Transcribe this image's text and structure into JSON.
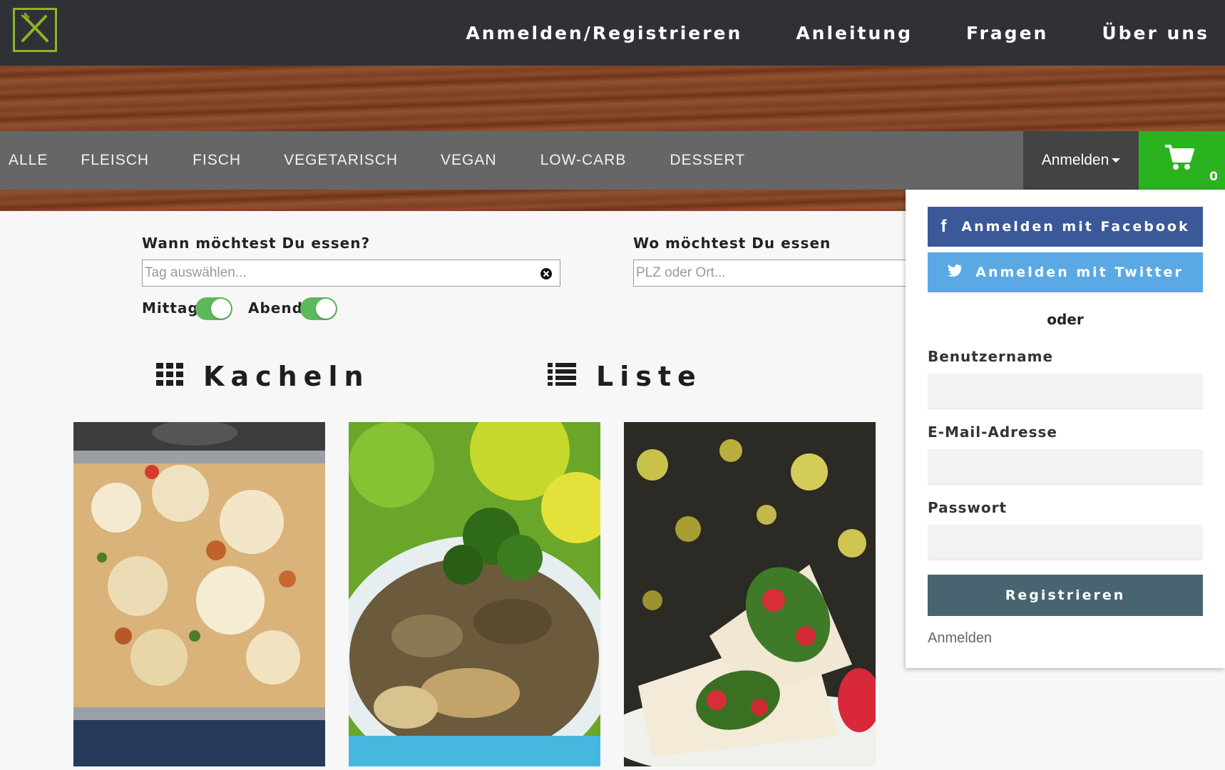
{
  "header": {
    "logo_icon": "fork-knife-icon",
    "nav": [
      "Anmelden/Registrieren",
      "Anleitung",
      "Fragen",
      "Über uns"
    ]
  },
  "categories": [
    "ALLE",
    "FLEISCH",
    "FISCH",
    "VEGETARISCH",
    "VEGAN",
    "LOW-CARB",
    "DESSERT"
  ],
  "account": {
    "dropdown_label": "Anmelden",
    "cart_count": "0"
  },
  "filters": {
    "when_label": "Wann möchtest Du essen?",
    "when_placeholder": "Tag auswählen...",
    "where_label": "Wo möchtest Du essen",
    "where_placeholder": "PLZ oder Ort...",
    "mittag_label": "Mittag",
    "abend_label": "Abend",
    "mittag_on": true,
    "abend_on": true
  },
  "views": {
    "tiles_label": "Kacheln",
    "list_label": "Liste"
  },
  "login": {
    "facebook_label": "Anmelden mit Facebook",
    "twitter_label": "Anmelden mit Twitter",
    "or_label": "oder",
    "username_label": "Benutzername",
    "email_label": "E-Mail-Adresse",
    "password_label": "Passwort",
    "register_label": "Registrieren",
    "login_link": "Anmelden"
  },
  "colors": {
    "topbar": "#2f3137",
    "catbar": "#666666",
    "cart": "#2ab31f",
    "toggle": "#5cb85c",
    "facebook": "#3b5998",
    "twitter": "#5aa9e4",
    "register": "#476470"
  }
}
